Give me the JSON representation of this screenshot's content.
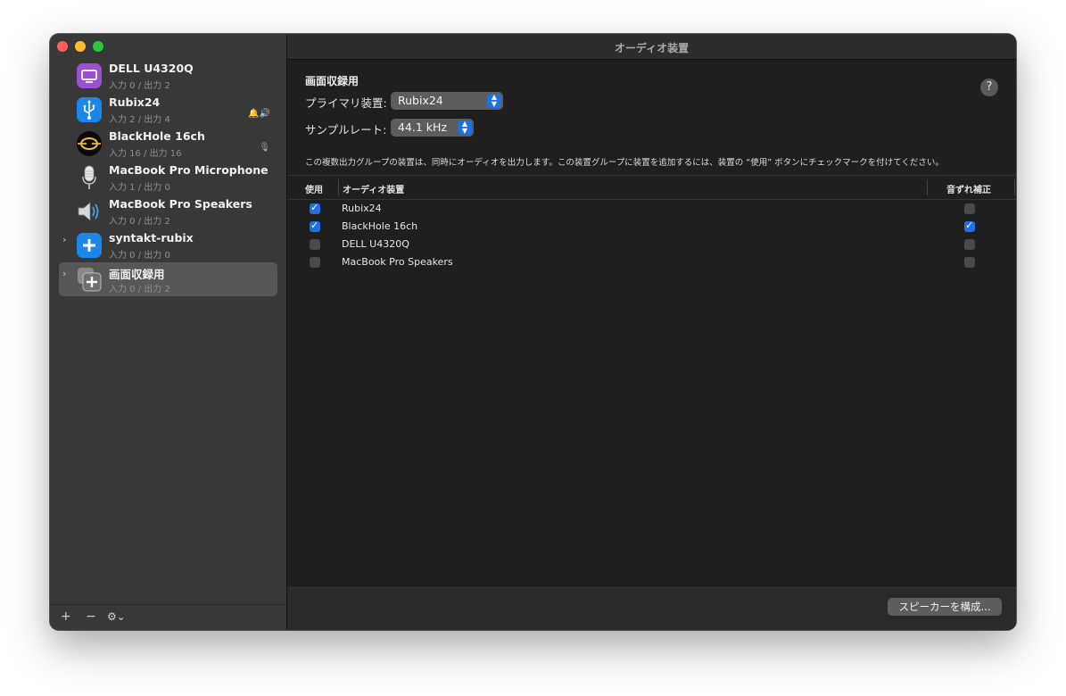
{
  "window": {
    "title": "オーディオ装置"
  },
  "sidebar": {
    "devices": [
      {
        "name": "DELL U4320Q",
        "io": "入力 0 / 出力 2",
        "icon": "display-icon"
      },
      {
        "name": "Rubix24",
        "io": "入力 2 / 出力 4",
        "icon": "usb-icon",
        "indicator": "🔔🔊"
      },
      {
        "name": "BlackHole 16ch",
        "io": "入力 16 / 出力 16",
        "icon": "blackhole-icon",
        "indicator": "🎙"
      },
      {
        "name": "MacBook Pro Microphone",
        "io": "入力 1 / 出力 0",
        "icon": "microphone-icon"
      },
      {
        "name": "MacBook Pro Speakers",
        "io": "入力 0 / 出力 2",
        "icon": "speaker-icon"
      },
      {
        "name": "syntakt-rubix",
        "io": "入力 0 / 出力 0",
        "icon": "aggregate-device-icon"
      },
      {
        "name": "画面収録用",
        "io": "入力 0 / 出力 2",
        "icon": "multi-output-device-icon"
      }
    ],
    "add_glyph": "+",
    "remove_glyph": "−",
    "actions_glyph": "⚙⌄"
  },
  "main": {
    "group_title": "画面収録用",
    "primary_label": "プライマリ装置:",
    "primary_value": "Rubix24",
    "rate_label": "サンプルレート:",
    "rate_value": "44.1 kHz",
    "help_glyph": "?",
    "description": "この複数出力グループの装置は、同時にオーディオを出力します。この装置グループに装置を追加するには、装置の “使用” ボタンにチェックマークを付けてください。",
    "table": {
      "headers": {
        "use": "使用",
        "device": "オーディオ装置",
        "drift": "音ずれ補正"
      },
      "rows": [
        {
          "use": true,
          "name": "Rubix24",
          "drift": false
        },
        {
          "use": true,
          "name": "BlackHole 16ch",
          "drift": true
        },
        {
          "use": false,
          "name": "DELL U4320Q",
          "drift": false
        },
        {
          "use": false,
          "name": "MacBook Pro Speakers",
          "drift": false
        }
      ]
    },
    "configure_button": "スピーカーを構成..."
  },
  "colors": {
    "accent": "#1f6fe5",
    "selected_row": "#575757"
  }
}
